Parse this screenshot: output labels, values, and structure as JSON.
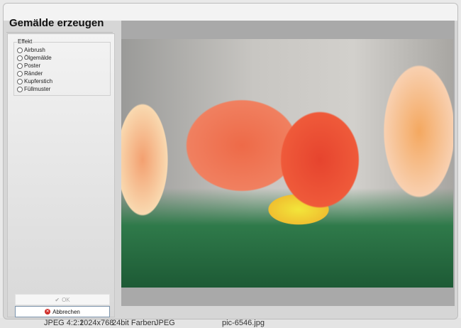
{
  "dialog": {
    "title": "Gemälde erzeugen",
    "effect_group": {
      "label": "Effekt",
      "options": [
        "Airbrush",
        "Ölgemälde",
        "Poster",
        "Ränder",
        "Kupferstich",
        "Füllmuster"
      ],
      "selected": null
    },
    "ok_label": "OK",
    "ok_icon": "checkmark-icon",
    "cancel_label": "Abbrechen",
    "cancel_icon": "cancel-icon"
  },
  "statusbar": {
    "format": "JPEG 4:2:2",
    "dimensions": "1024x768",
    "colors": "24bit Farben",
    "type": "JPEG",
    "filename": "pic-6546.jpg"
  }
}
